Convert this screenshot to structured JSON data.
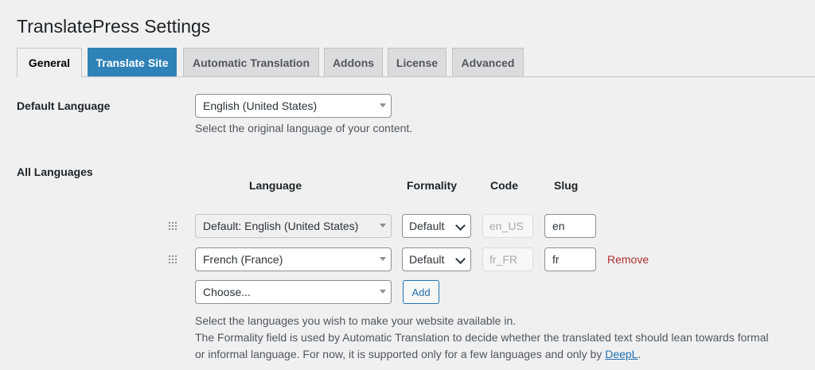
{
  "page": {
    "title": "TranslatePress Settings"
  },
  "tabs": [
    {
      "label": "General"
    },
    {
      "label": "Translate Site"
    },
    {
      "label": "Automatic Translation"
    },
    {
      "label": "Addons"
    },
    {
      "label": "License"
    },
    {
      "label": "Advanced"
    }
  ],
  "default_language": {
    "label": "Default Language",
    "value": "English (United States)",
    "help": "Select the original language of your content."
  },
  "all_languages": {
    "label": "All Languages",
    "columns": {
      "language": "Language",
      "formality": "Formality",
      "code": "Code",
      "slug": "Slug"
    },
    "rows": [
      {
        "language": "Default: English (United States)",
        "formality": "Default",
        "code": "en_US",
        "slug": "en",
        "remove": ""
      },
      {
        "language": "French (France)",
        "formality": "Default",
        "code": "fr_FR",
        "slug": "fr",
        "remove": "Remove"
      }
    ],
    "choose_placeholder": "Choose...",
    "add_label": "Add",
    "help_line1": "Select the languages you wish to make your website available in.",
    "help_line2": "The Formality field is used by Automatic Translation to decide whether the translated text should lean towards formal",
    "help_line3_prefix": "or informal language. For now, it is supported only for a few languages and only by ",
    "help_link": "DeepL",
    "help_line3_suffix": "."
  },
  "colors": {
    "accent": "#2271b1",
    "tab_active_blue": "#2f82b8",
    "remove": "#b32d2e"
  }
}
